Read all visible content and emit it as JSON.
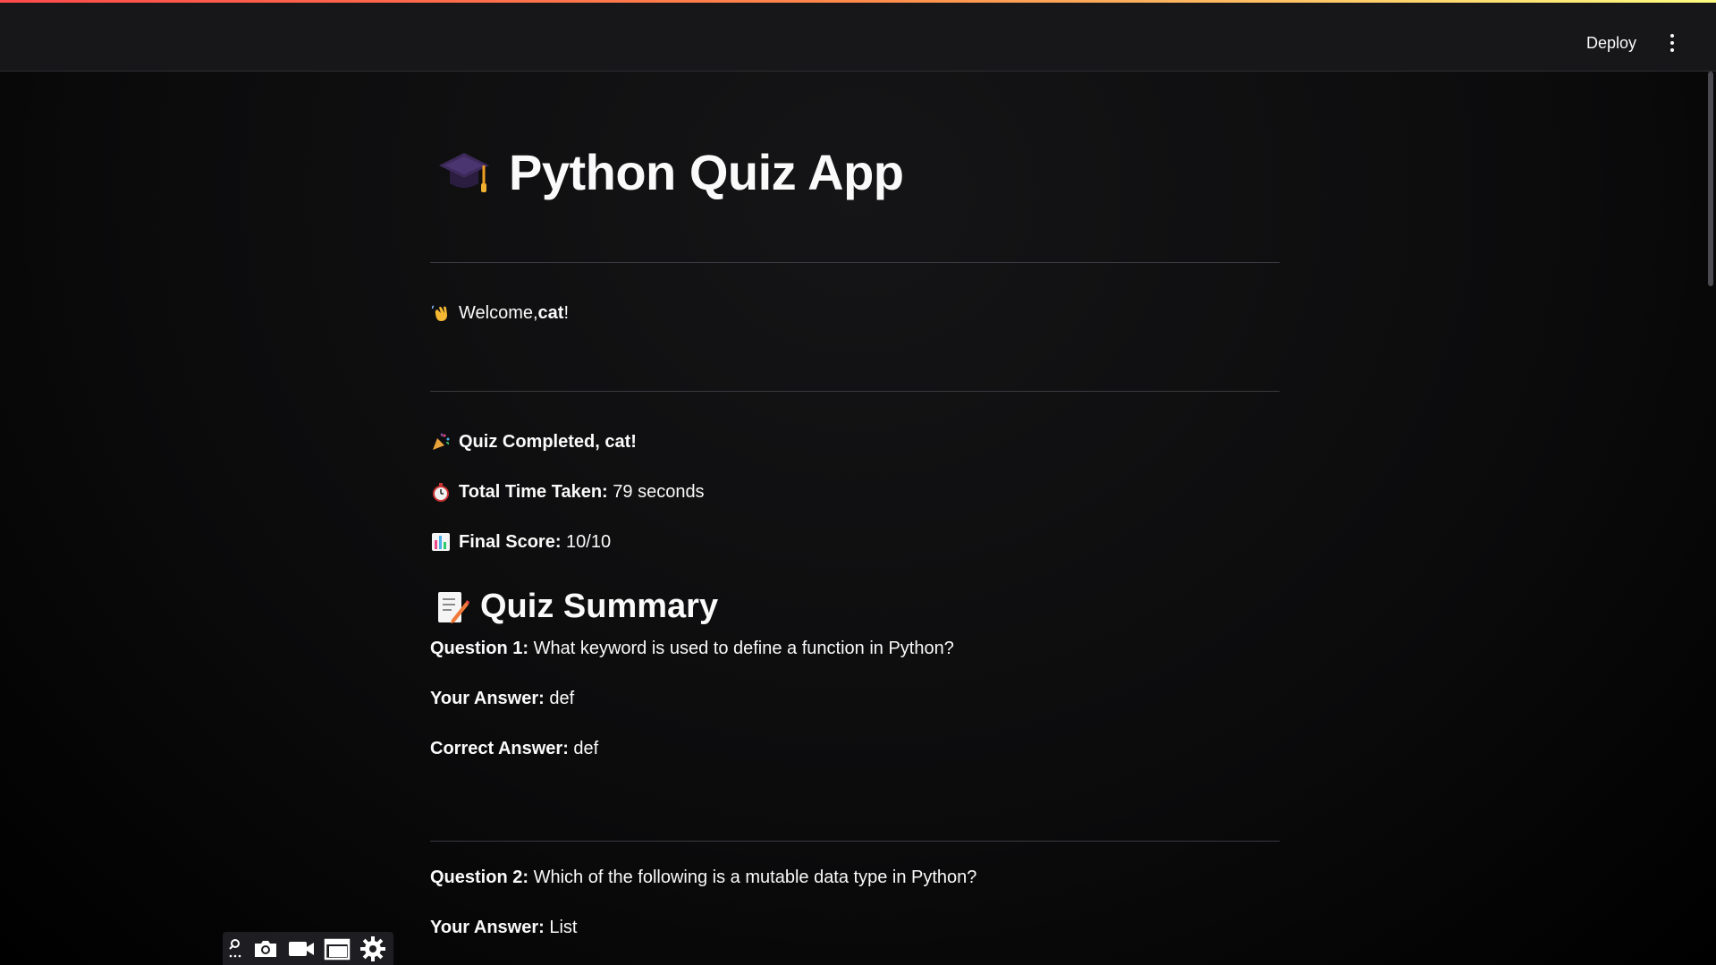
{
  "header": {
    "deploy_label": "Deploy",
    "menu_icon": "vertical-ellipsis-icon"
  },
  "app": {
    "title": "Python Quiz App",
    "title_icon": "graduation-cap-icon",
    "welcome_prefix": "Welcome, ",
    "welcome_name": "cat",
    "welcome_suffix": "!",
    "welcome_icon": "waving-hand-icon"
  },
  "results": {
    "completed_text": "Quiz Completed, cat!",
    "completed_icon": "party-popper-icon",
    "time_label": "Total Time Taken:",
    "time_value": "79 seconds",
    "time_icon": "stopwatch-icon",
    "score_label": "Final Score:",
    "score_value": "10/10",
    "score_icon": "bar-chart-icon"
  },
  "summary": {
    "heading": "Quiz Summary",
    "heading_icon": "memo-icon",
    "items": [
      {
        "q_label": "Question 1:",
        "q_text": "What keyword is used to define a function in Python?",
        "your_label": "Your Answer:",
        "your_value": "def",
        "correct_label": "Correct Answer:",
        "correct_value": "def"
      },
      {
        "q_label": "Question 2:",
        "q_text": "Which of the following is a mutable data type in Python?",
        "your_label": "Your Answer:",
        "your_value": "List"
      }
    ]
  },
  "toolbar": {
    "icons": [
      "screen-draw-icon",
      "camera-icon",
      "video-camera-icon",
      "window-icon",
      "gear-icon"
    ]
  },
  "colors": {
    "accent_gradient_start": "#ff4b4b",
    "accent_gradient_end": "#fffd80",
    "background": "#0e0e10",
    "text": "#fafafa"
  }
}
